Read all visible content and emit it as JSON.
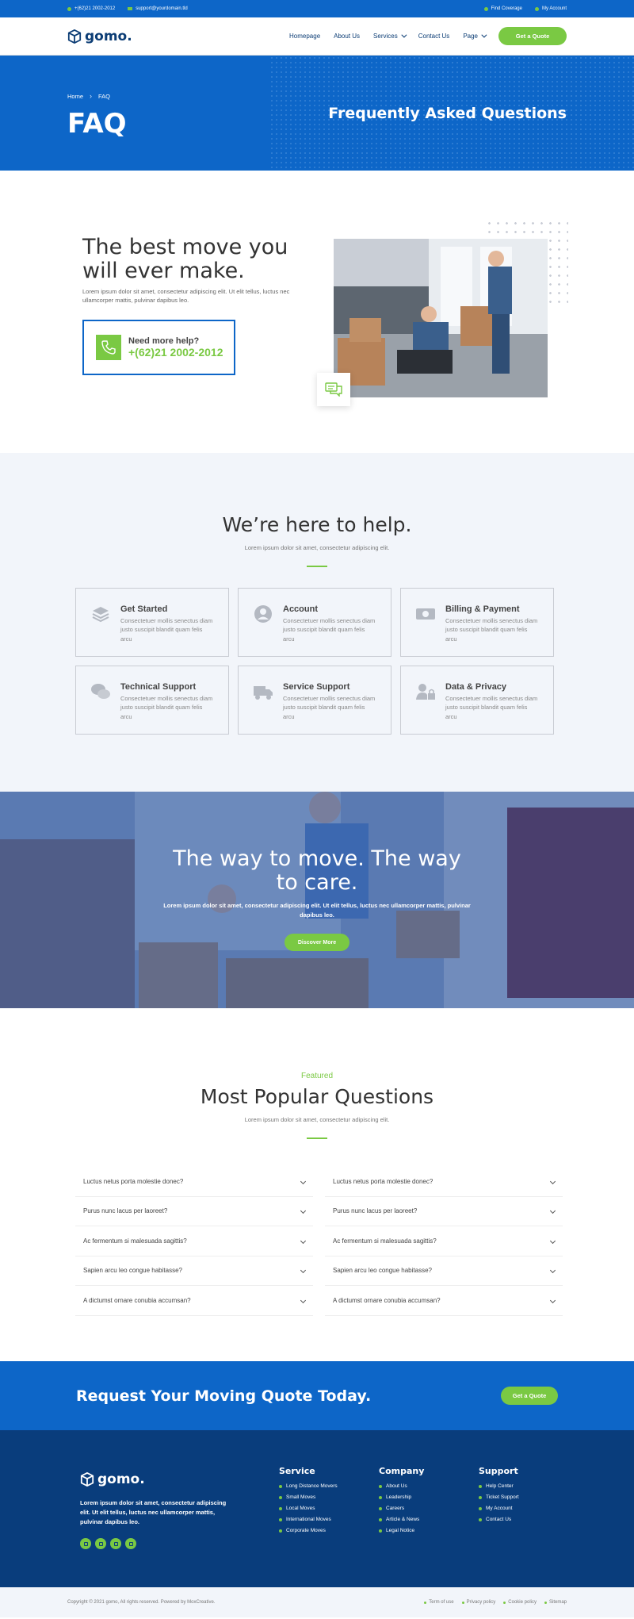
{
  "topbar": {
    "phone": "+(62)21 2002-2012",
    "email": "support@yourdomain.tld",
    "find_coverage": "Find Coverage",
    "my_account": "My Account"
  },
  "brand": {
    "name": "gomo.",
    "accent": "#7ac943",
    "primary": "#0d66c8",
    "dark": "#093d7c"
  },
  "nav": {
    "items": [
      "Homepage",
      "About Us",
      "Services",
      "Contact Us",
      "Page"
    ],
    "cta": "Get a Quote"
  },
  "hero": {
    "breadcrumb": [
      "Home",
      "FAQ"
    ],
    "title": "FAQ",
    "subtitle": "Frequently Asked Questions"
  },
  "intro": {
    "heading": "The best move you will ever make.",
    "text": "Lorem ipsum dolor sit amet, consectetur adipiscing elit. Ut elit tellus, luctus nec ullamcorper mattis, pulvinar dapibus leo.",
    "help_label": "Need more help?",
    "help_phone": "+(62)21 2002-2012"
  },
  "help": {
    "title": "We’re here to help.",
    "subtitle": "Lorem ipsum dolor sit amet, consectetur adipiscing elit.",
    "cards": [
      {
        "title": "Get Started",
        "text": "Consectetuer mollis senectus diam justo suscipit blandit quam felis arcu",
        "icon": "layers-icon"
      },
      {
        "title": "Account",
        "text": "Consectetuer mollis senectus diam justo suscipit blandit quam felis arcu",
        "icon": "user-circle-icon"
      },
      {
        "title": "Billing & Payment",
        "text": "Consectetuer mollis senectus diam justo suscipit blandit quam felis arcu",
        "icon": "money-bill-icon"
      },
      {
        "title": "Technical Support",
        "text": "Consectetuer mollis senectus diam justo suscipit blandit quam felis arcu",
        "icon": "chat-bubbles-icon"
      },
      {
        "title": "Service Support",
        "text": "Consectetuer mollis senectus diam justo suscipit blandit quam felis arcu",
        "icon": "truck-icon"
      },
      {
        "title": "Data & Privacy",
        "text": "Consectetuer mollis senectus diam justo suscipit blandit quam felis arcu",
        "icon": "user-lock-icon"
      }
    ]
  },
  "banner": {
    "title": "The way to move. The way to care.",
    "text": "Lorem ipsum dolor sit amet, consectetur adipiscing elit. Ut elit tellus, luctus nec ullamcorper mattis, pulvinar dapibus leo.",
    "button": "Discover More"
  },
  "faq": {
    "kicker": "Featured",
    "title": "Most Popular Questions",
    "subtitle": "Lorem ipsum dolor sit amet, consectetur adipiscing elit.",
    "left": [
      "Luctus netus porta molestie donec?",
      "Purus nunc lacus per laoreet?",
      "Ac fermentum si malesuada sagittis?",
      "Sapien arcu leo congue habitasse?",
      "A dictumst ornare conubia accumsan?"
    ],
    "right": [
      "Luctus netus porta molestie donec?",
      "Purus nunc lacus per laoreet?",
      "Ac fermentum si malesuada sagittis?",
      "Sapien arcu leo congue habitasse?",
      "A dictumst ornare conubia accumsan?"
    ]
  },
  "cta": {
    "title": "Request Your Moving Quote Today.",
    "button": "Get a Quote"
  },
  "footer": {
    "desc": "Lorem ipsum dolor sit amet, consectetur adipiscing elit. Ut elit tellus, luctus nec ullamcorper mattis, pulvinar dapibus leo.",
    "service": {
      "title": "Service",
      "links": [
        "Long Distance Movers",
        "Small Moves",
        "Local Moves",
        "International Moves",
        "Corporate Moves"
      ]
    },
    "company": {
      "title": "Company",
      "links": [
        "About Us",
        "Leadership",
        "Careers",
        "Article & News",
        "Legal Notice"
      ]
    },
    "support": {
      "title": "Support",
      "links": [
        "Help Center",
        "Ticket Support",
        "My Account",
        "Contact Us"
      ]
    },
    "copyright": "Copyright © 2021 gomo, All rights reserved. Powered by MoxCreative.",
    "legal": [
      "Term of use",
      "Privacy policy",
      "Cookie policy",
      "Sitemap"
    ]
  }
}
